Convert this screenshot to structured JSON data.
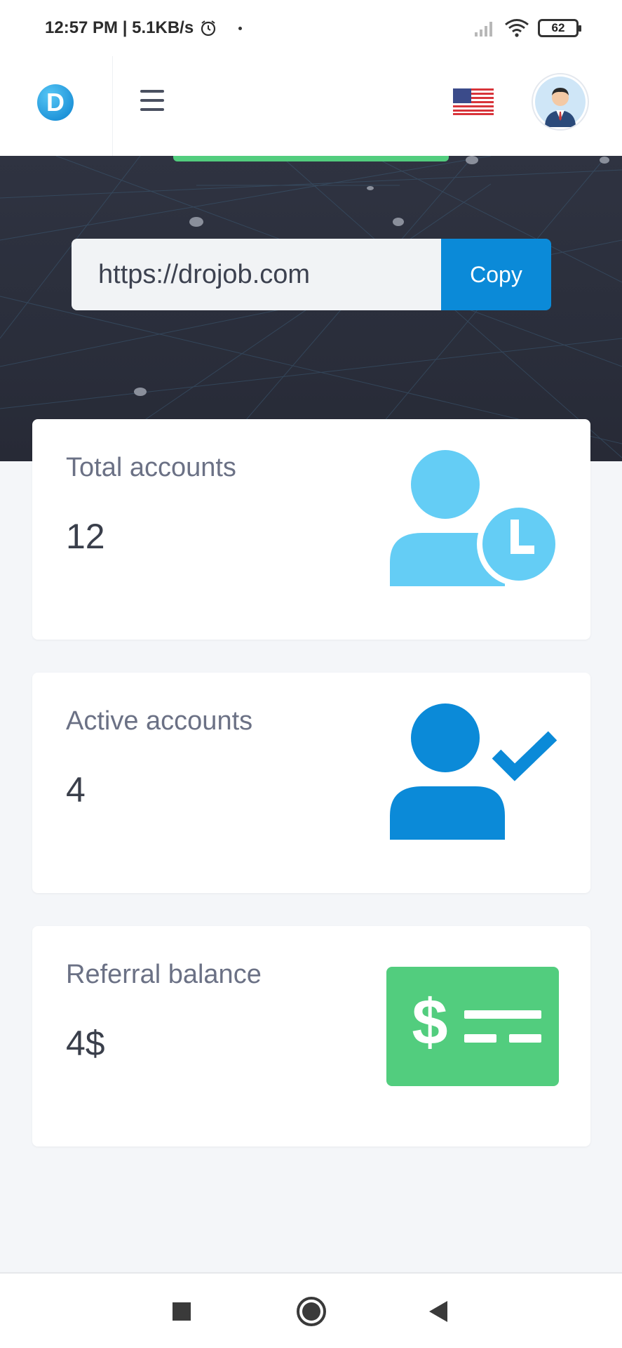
{
  "status_bar": {
    "time": "12:57 PM",
    "speed": "5.1KB/s",
    "battery": "62",
    "icons": [
      "alarm-clock-icon",
      "signal-icon",
      "wifi-icon",
      "battery-icon"
    ]
  },
  "header": {
    "logo_letter": "D",
    "logo_color": "#0b82cf",
    "icons": [
      "menu-icon",
      "us-flag-icon",
      "avatar-icon"
    ]
  },
  "referral": {
    "link": "https://drojob.com",
    "copy_label": "Copy"
  },
  "cards": [
    {
      "title": "Total accounts",
      "value": "12",
      "icon": "user-clock-icon",
      "color": "#64cdf5"
    },
    {
      "title": "Active accounts",
      "value": "4",
      "icon": "user-check-icon",
      "color": "#0b8ad8"
    },
    {
      "title": "Referral balance",
      "value": "4$",
      "icon": "money-check-icon",
      "color": "#52cd7e"
    }
  ],
  "nav": {
    "icons": [
      "recents-square-icon",
      "home-circle-icon",
      "back-triangle-icon"
    ]
  }
}
